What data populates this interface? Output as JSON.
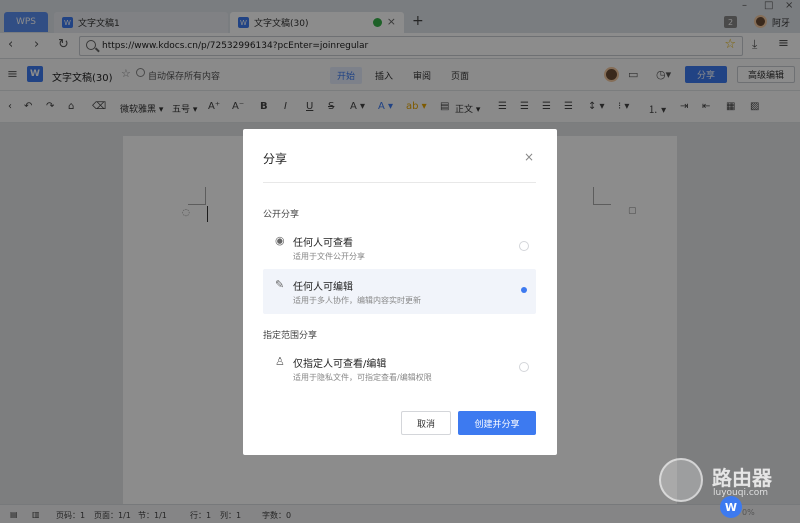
{
  "browser": {
    "wps_tab": "WPS",
    "tabs": [
      {
        "label": "文字文稿1"
      },
      {
        "label": "文字文稿(30)"
      }
    ],
    "badge_count": "2",
    "user_name": "阿牙",
    "url": "https://www.kdocs.cn/p/72532996134?pcEnter=joinregular"
  },
  "app": {
    "doc_title": "文字文稿(30)",
    "autosave": "自动保存所有内容",
    "menu_tabs": [
      "开始",
      "插入",
      "审阅",
      "页面"
    ],
    "share_label": "分享",
    "advanced_edit_label": "高级编辑"
  },
  "toolbar": {
    "font_family": "微软雅黑",
    "font_size": "五号",
    "paragraph_style": "正文"
  },
  "modal": {
    "title": "分享",
    "section_public": "公开分享",
    "section_restricted": "指定范围分享",
    "options": [
      {
        "title": "任何人可查看",
        "desc": "适用于文件公开分享",
        "selected": false
      },
      {
        "title": "任何人可编辑",
        "desc": "适用于多人协作，编辑内容实时更新",
        "selected": true
      },
      {
        "title": "仅指定人可查看/编辑",
        "desc": "适用于隐私文件，可指定查看/编辑权限",
        "selected": false
      }
    ],
    "cancel_label": "取消",
    "create_label": "创建并分享"
  },
  "statusbar": {
    "page_code": "页码：1",
    "page": "页面：1/1",
    "section": "节：1/1",
    "row": "行：1",
    "col": "列：1",
    "word_count": "字数：0",
    "zoom": "0%"
  },
  "watermark": {
    "main": "路由器",
    "sub": "luyouqi.com"
  },
  "colors": {
    "accent": "#3d7af0",
    "tab_wps": "#5a8ef0"
  }
}
